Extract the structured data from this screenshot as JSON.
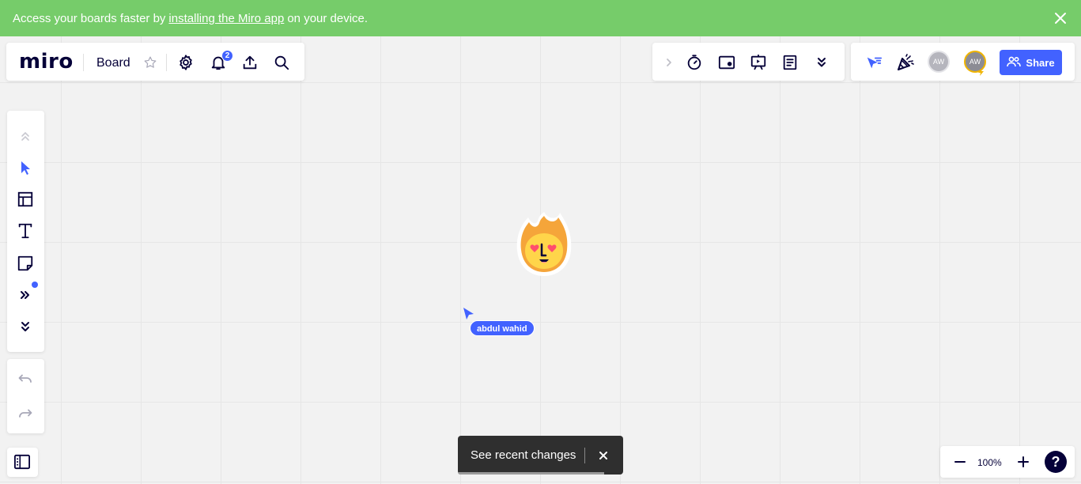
{
  "banner": {
    "text_before": "Access your boards faster by",
    "link_text": "installing the Miro app",
    "text_after": "on your device.",
    "bg_color": "#76cc6a"
  },
  "topbar": {
    "logo": "miro",
    "board_name": "Board",
    "notification_count": "2",
    "icons": [
      "star-icon",
      "gear-icon",
      "bell-icon",
      "upload-icon",
      "search-icon"
    ]
  },
  "toolbar_right": {
    "icons": [
      "chevron-right-icon",
      "timer-icon",
      "video-chat-icon",
      "presentation-icon",
      "notes-icon",
      "chevron-double-down-icon"
    ]
  },
  "collab": {
    "icons": [
      "cursor-filter-icon",
      "celebrate-icon"
    ],
    "avatar_1_initials": "AW",
    "avatar_2_initials": "AW",
    "share_label": "Share",
    "accent_color": "#4262ff"
  },
  "left_toolbar": {
    "tools": [
      "collapse-up-icon",
      "select-tool-icon",
      "frame-tool-icon",
      "text-tool-icon",
      "sticky-note-icon",
      "more-tools-icon",
      "expand-down-icon"
    ],
    "history": [
      "undo-icon",
      "redo-icon"
    ]
  },
  "canvas": {
    "cursor_user_name": "abdul wahid",
    "sticker": "fire-heart-eyes-sticker"
  },
  "toast": {
    "text": "See recent changes"
  },
  "zoom": {
    "level": "100%",
    "help": "?"
  }
}
